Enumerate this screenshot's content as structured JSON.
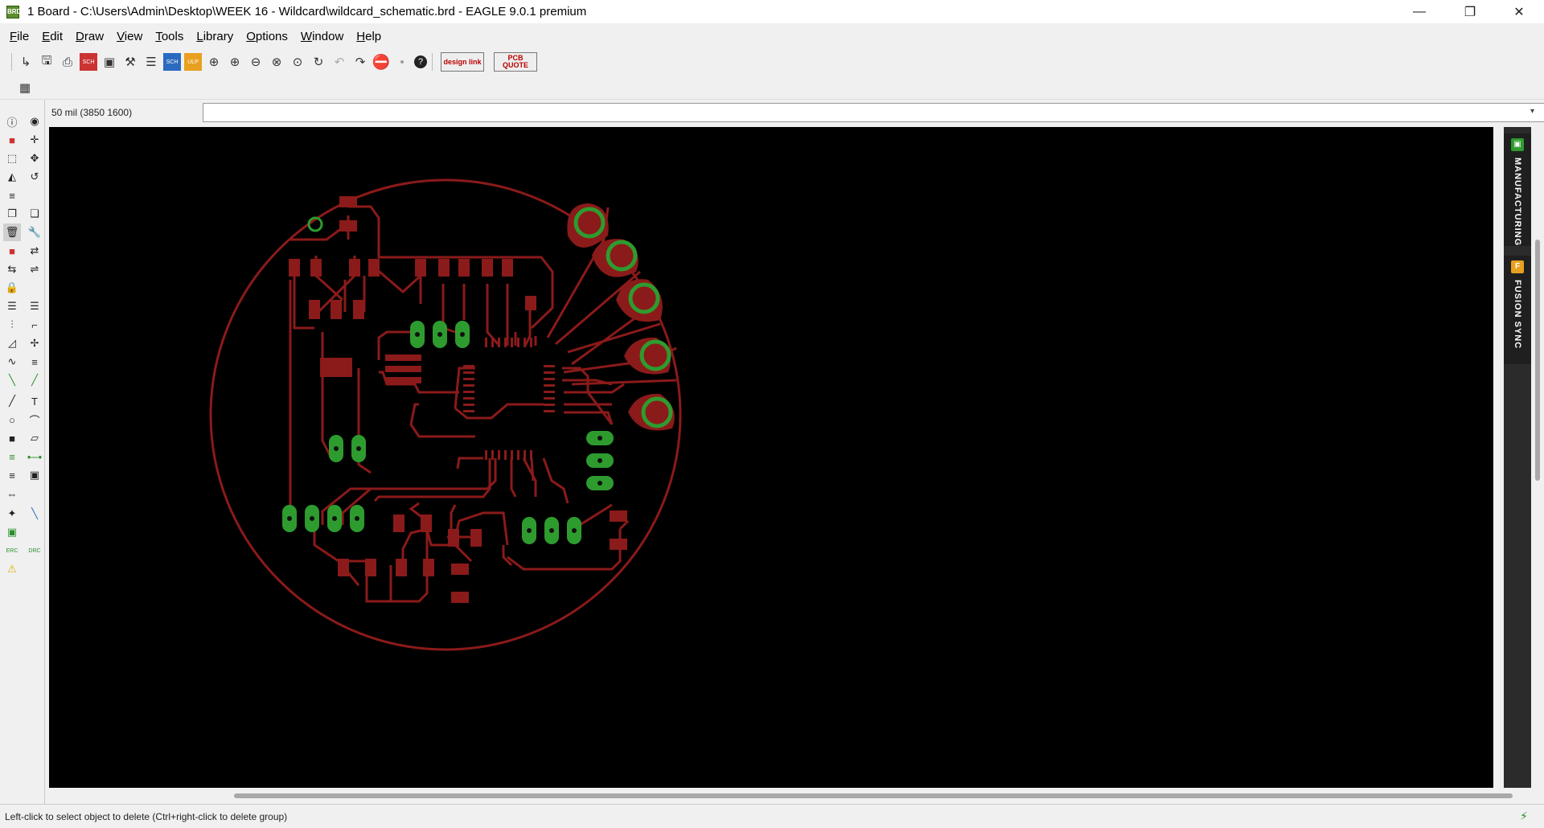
{
  "titlebar": {
    "app_icon_label": "BRD",
    "title": "1 Board - C:\\Users\\Admin\\Desktop\\WEEK 16 - Wildcard\\wildcard_schematic.brd - EAGLE 9.0.1 premium",
    "minimize_glyph": "—",
    "maximize_glyph": "❐",
    "close_glyph": "✕"
  },
  "menu": {
    "items": [
      {
        "hot": "F",
        "rest": "ile"
      },
      {
        "hot": "E",
        "rest": "dit"
      },
      {
        "hot": "D",
        "rest": "raw"
      },
      {
        "hot": "V",
        "rest": "iew"
      },
      {
        "hot": "T",
        "rest": "ools"
      },
      {
        "hot": "L",
        "rest": "ibrary"
      },
      {
        "hot": "O",
        "rest": "ptions"
      },
      {
        "hot": "W",
        "rest": "indow"
      },
      {
        "hot": "H",
        "rest": "elp"
      }
    ]
  },
  "toolbar": {
    "design_link_label": "design link",
    "pcb_quote_label": "PCB QUOTE",
    "sch_label": "SCH",
    "ulp_label": "ULP",
    "help_glyph": "?"
  },
  "coord": {
    "readout": "50 mil (3850 1600)",
    "command_value": "",
    "dropdown_glyph": "▾"
  },
  "right_panel": {
    "manufacturing_label": "MANUFACTURING",
    "fusion_label": "FUSION SYNC",
    "manufacturing_icon": "▣",
    "fusion_icon": "F"
  },
  "sidebar": {
    "erc_label": "ERC",
    "drc_label": "DRC",
    "text_tool_glyph": "T"
  },
  "status": {
    "message": "Left-click to select object to delete (Ctrl+right-click to delete group)",
    "icon_glyph": "⚡"
  },
  "colors": {
    "copper": "#8b1a1a",
    "via": "#2e9b2e",
    "background": "#000000"
  }
}
